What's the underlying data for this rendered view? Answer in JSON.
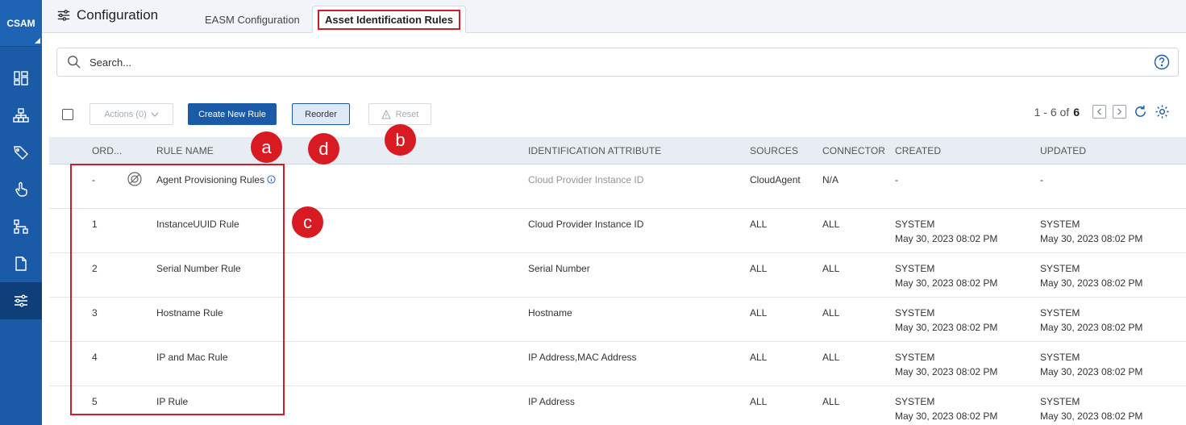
{
  "brand": {
    "label": "CSAM"
  },
  "sidebar": {
    "items": [
      {
        "name": "dashboard-icon"
      },
      {
        "name": "assets-icon"
      },
      {
        "name": "tag-icon"
      },
      {
        "name": "touch-icon"
      },
      {
        "name": "hierarchy-icon"
      },
      {
        "name": "document-icon"
      },
      {
        "name": "sliders-icon",
        "active": true
      }
    ]
  },
  "header": {
    "title": "Configuration",
    "tabs": [
      {
        "label": "EASM Configuration",
        "active": false
      },
      {
        "label": "Asset Identification Rules",
        "active": true
      }
    ]
  },
  "search": {
    "placeholder": "Search..."
  },
  "toolbar": {
    "actions_label": "Actions (0)",
    "create_label": "Create New Rule",
    "reorder_label": "Reorder",
    "reset_label": "Reset",
    "pager_text": "1 - 6 of",
    "pager_total": "6"
  },
  "table": {
    "columns": {
      "order": "ORD...",
      "rule_name": "RULE NAME",
      "identification_attribute": "IDENTIFICATION ATTRIBUTE",
      "sources": "SOURCES",
      "connector": "CONNECTOR",
      "created": "CREATED",
      "updated": "UPDATED"
    },
    "rows": [
      {
        "order": "-",
        "rule_name": "Agent Provisioning Rules",
        "identification_attribute": "Cloud Provider Instance ID",
        "sources": "CloudAgent",
        "connector": "N/A",
        "created_by": "-",
        "created_date": "",
        "updated_by": "-",
        "updated_date": ""
      },
      {
        "order": "1",
        "rule_name": "InstanceUUID Rule",
        "identification_attribute": "Cloud Provider Instance ID",
        "sources": "ALL",
        "connector": "ALL",
        "created_by": "SYSTEM",
        "created_date": "May 30, 2023 08:02 PM",
        "updated_by": "SYSTEM",
        "updated_date": "May 30, 2023 08:02 PM"
      },
      {
        "order": "2",
        "rule_name": "Serial Number Rule",
        "identification_attribute": "Serial Number",
        "sources": "ALL",
        "connector": "ALL",
        "created_by": "SYSTEM",
        "created_date": "May 30, 2023 08:02 PM",
        "updated_by": "SYSTEM",
        "updated_date": "May 30, 2023 08:02 PM"
      },
      {
        "order": "3",
        "rule_name": "Hostname Rule",
        "identification_attribute": "Hostname",
        "sources": "ALL",
        "connector": "ALL",
        "created_by": "SYSTEM",
        "created_date": "May 30, 2023 08:02 PM",
        "updated_by": "SYSTEM",
        "updated_date": "May 30, 2023 08:02 PM"
      },
      {
        "order": "4",
        "rule_name": "IP and Mac Rule",
        "identification_attribute": "IP Address,MAC Address",
        "sources": "ALL",
        "connector": "ALL",
        "created_by": "SYSTEM",
        "created_date": "May 30, 2023 08:02 PM",
        "updated_by": "SYSTEM",
        "updated_date": "May 30, 2023 08:02 PM"
      },
      {
        "order": "5",
        "rule_name": "IP Rule",
        "identification_attribute": "IP Address",
        "sources": "ALL",
        "connector": "ALL",
        "created_by": "SYSTEM",
        "created_date": "May 30, 2023 08:02 PM",
        "updated_by": "SYSTEM",
        "updated_date": "May 30, 2023 08:02 PM"
      }
    ]
  },
  "annotations": {
    "a": "a",
    "b": "b",
    "c": "c",
    "d": "d",
    "color": "#d81a22"
  },
  "colors": {
    "brand": "#1a5aa6",
    "primary_button": "#1a5aa6",
    "highlight": "#cc1f2a"
  }
}
